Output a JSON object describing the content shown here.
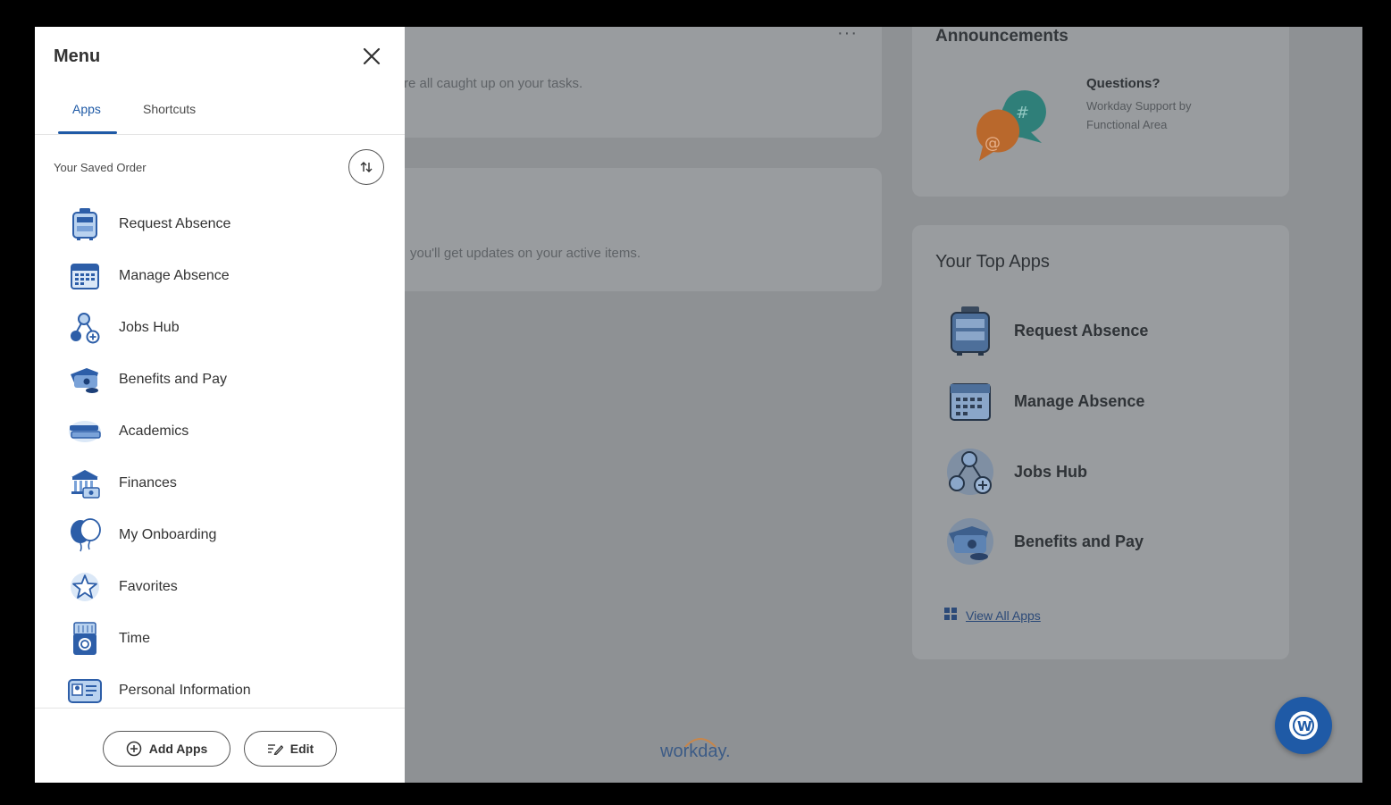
{
  "menu": {
    "title": "Menu",
    "tabs": {
      "apps": "Apps",
      "shortcuts": "Shortcuts"
    },
    "saved_order_label": "Your Saved Order",
    "items": [
      {
        "label": "Request Absence",
        "icon": "suitcase-icon"
      },
      {
        "label": "Manage Absence",
        "icon": "calendar-icon"
      },
      {
        "label": "Jobs Hub",
        "icon": "org-chart-icon"
      },
      {
        "label": "Benefits and Pay",
        "icon": "wallet-icon"
      },
      {
        "label": "Academics",
        "icon": "books-icon"
      },
      {
        "label": "Finances",
        "icon": "bank-icon"
      },
      {
        "label": "My Onboarding",
        "icon": "balloons-icon"
      },
      {
        "label": "Favorites",
        "icon": "star-icon"
      },
      {
        "label": "Time",
        "icon": "time-clock-icon"
      },
      {
        "label": "Personal Information",
        "icon": "id-card-icon"
      }
    ],
    "footer": {
      "add_apps": "Add Apps",
      "edit": "Edit"
    }
  },
  "background": {
    "tasks_text": "re all caught up on your tasks.",
    "updates_text": "you'll get updates on your active items.",
    "more_label": "···",
    "announcements": {
      "title": "Announcements",
      "item_title": "Questions?",
      "item_subtitle": "Workday Support by Functional Area"
    },
    "top_apps": {
      "title": "Your Top Apps",
      "items": [
        {
          "label": "Request Absence",
          "icon": "suitcase-icon"
        },
        {
          "label": "Manage Absence",
          "icon": "calendar-icon"
        },
        {
          "label": "Jobs Hub",
          "icon": "org-chart-icon"
        },
        {
          "label": "Benefits and Pay",
          "icon": "wallet-icon"
        }
      ],
      "view_all": "View All Apps"
    },
    "wordmark": "workday."
  },
  "colors": {
    "accent": "#1f5aa6",
    "overlay": "#8e9194",
    "icon_light": "#b9d2ef"
  }
}
